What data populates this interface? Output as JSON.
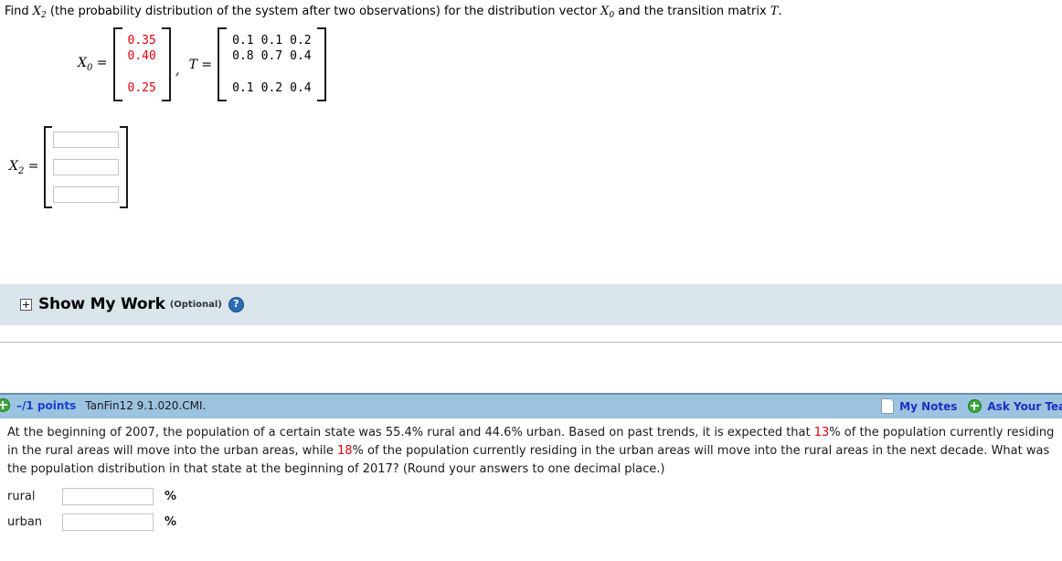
{
  "question1": {
    "prompt_before": "Find ",
    "prompt_var": "X",
    "prompt_sub": "2",
    "prompt_mid": " (the probability distribution of the system after two observations) for the distribution vector ",
    "prompt_var2": "X",
    "prompt_sub2": "0",
    "prompt_mid2": " and the transition matrix ",
    "prompt_var3": "T",
    "prompt_end": ".",
    "x0_label": "X",
    "x0_sub": "0",
    "equals": "=",
    "comma": ",",
    "t_label": "T",
    "x0_values": [
      "0.35",
      "0.40",
      "0.25"
    ],
    "t_matrix": [
      [
        "0.1",
        "0.1",
        "0.2"
      ],
      [
        "0.8",
        "0.7",
        "0.4"
      ],
      [
        "0.1",
        "0.2",
        "0.4"
      ]
    ],
    "answer_label": "X",
    "answer_sub": "2",
    "answer_values": [
      "",
      "",
      ""
    ],
    "value_color": "#e8000d"
  },
  "show_my_work": {
    "expander": "plus-expander",
    "title": "Show My Work",
    "optional": "(Optional)",
    "help": "?",
    "background": "#d9e4eb"
  },
  "points_bar": {
    "expand_icon": "green-plus-icon",
    "points": "–/1 points",
    "question_id": "TanFin12 9.1.020.CMI.",
    "my_notes": "My Notes",
    "ask_teacher": "Ask Your Teacher",
    "background": "#9cc3e0",
    "link_color": "#1a2fc0"
  },
  "question2": {
    "line1_a": "At the beginning of 2007, the population of a certain state was 55.4% rural and 44.6% urban. Based on past trends, it is expected that ",
    "line1_hl": "13",
    "line1_b": "% of the population currently",
    "line2_a": "residing in the rural areas will move into the urban areas, while ",
    "line2_hl": "18",
    "line2_b": "% of the population currently residing in the urban areas will move into the rural areas in the next decade.",
    "line3": "What was the population distribution in that state at the beginning of 2017? (Round your answers to one decimal place.)",
    "fields": [
      {
        "label": "rural",
        "value": "",
        "unit": "%"
      },
      {
        "label": "urban",
        "value": "",
        "unit": "%"
      }
    ],
    "highlight_color": "#e8000d"
  }
}
